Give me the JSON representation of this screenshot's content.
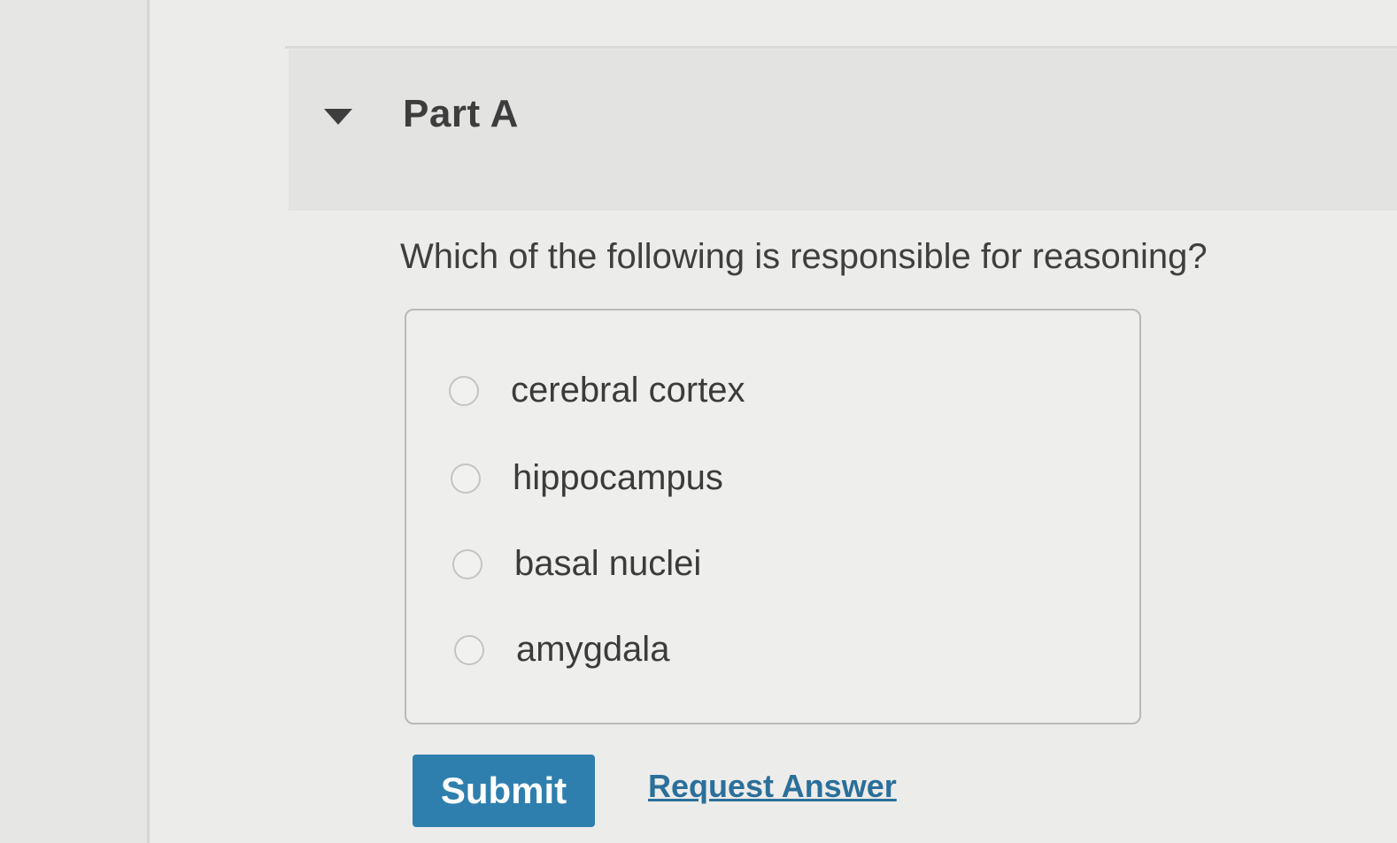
{
  "part": {
    "title": "Part A",
    "toggle_icon": "caret-down-icon"
  },
  "question": {
    "text": "Which of the following is responsible for reasoning?"
  },
  "options": [
    {
      "label": "cerebral cortex",
      "selected": false
    },
    {
      "label": "hippocampus",
      "selected": false
    },
    {
      "label": "basal nuclei",
      "selected": false
    },
    {
      "label": "amygdala",
      "selected": false
    }
  ],
  "actions": {
    "submit_label": "Submit",
    "request_answer_label": "Request Answer"
  },
  "colors": {
    "accent": "#2f7fae",
    "link": "#2b6f9a",
    "text": "#3a3a3a"
  }
}
